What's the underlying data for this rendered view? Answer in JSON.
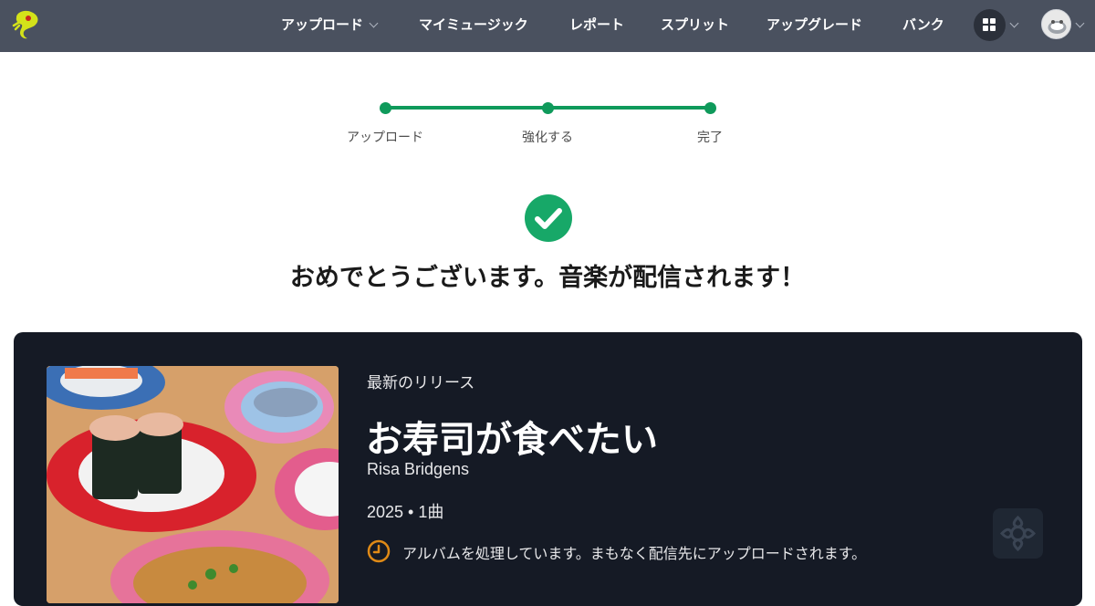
{
  "nav": {
    "items": [
      {
        "label": "アップロード",
        "has_dropdown": true
      },
      {
        "label": "マイミュージック",
        "has_dropdown": false
      },
      {
        "label": "レポート",
        "has_dropdown": false
      },
      {
        "label": "スプリット",
        "has_dropdown": false
      },
      {
        "label": "アップグレード",
        "has_dropdown": false
      },
      {
        "label": "バンク",
        "has_dropdown": false
      }
    ],
    "apps_icon": "grid-icon",
    "avatar_icon": "avatar-icon",
    "bg_color": "#4a515f"
  },
  "stepper": {
    "steps": [
      {
        "label": "アップロード",
        "complete": true
      },
      {
        "label": "強化する",
        "complete": true
      },
      {
        "label": "完了",
        "complete": true
      }
    ],
    "color": "#0f9a5b"
  },
  "success": {
    "icon": "check-circle-icon",
    "headline": "おめでとうございます。音楽が配信されます！"
  },
  "release": {
    "section_label": "最新のリリース",
    "title": "お寿司が食べたい",
    "artist": "Risa Bridgens",
    "meta": "2025 • 1曲",
    "status_icon": "clock-icon",
    "status_text": "アルバムを処理しています。まもなく配信先にアップロードされます。",
    "accent_color": "#e08a16",
    "card_color": "#151a25"
  }
}
